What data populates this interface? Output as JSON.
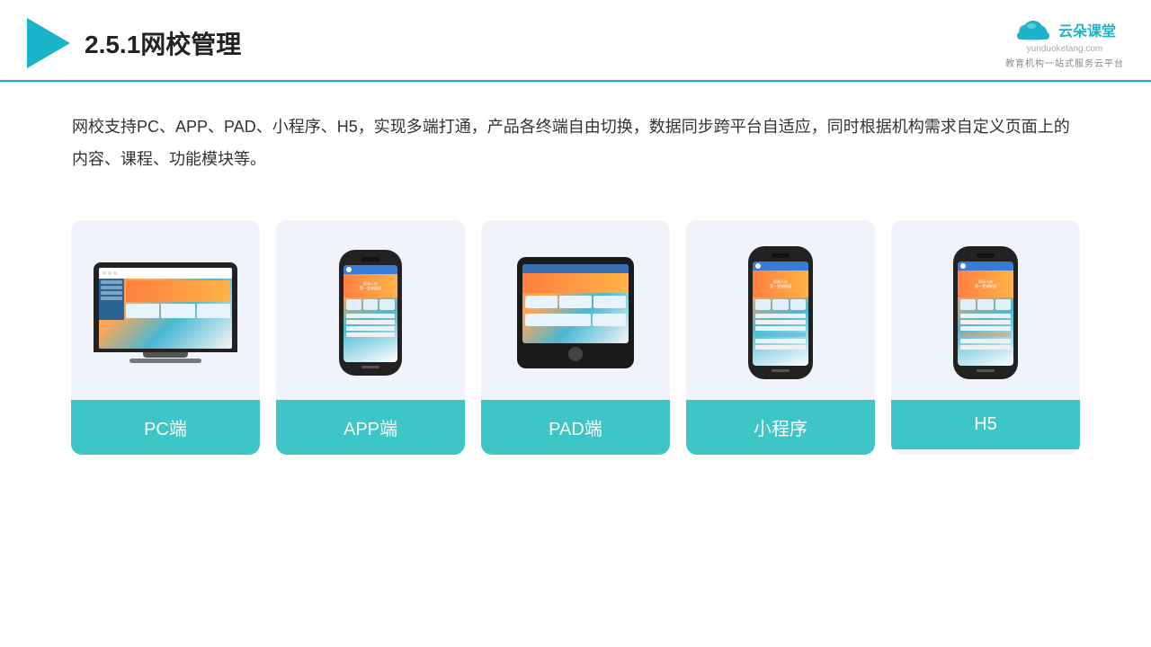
{
  "header": {
    "title": "2.5.1网校管理",
    "brand_name": "云朵课堂",
    "brand_url": "yunduoketang.com",
    "brand_subtitle": "教育机构一站\n式服务云平台"
  },
  "description": {
    "text": "网校支持PC、APP、PAD、小程序、H5，实现多端打通，产品各终端自由切换，数据同步跨平台自适应，同时根据机构需求自定义页面上的内容、课程、功能模块等。"
  },
  "cards": [
    {
      "id": "pc",
      "label": "PC端"
    },
    {
      "id": "app",
      "label": "APP端"
    },
    {
      "id": "pad",
      "label": "PAD端"
    },
    {
      "id": "mini",
      "label": "小程序"
    },
    {
      "id": "h5",
      "label": "H5"
    }
  ],
  "colors": {
    "teal": "#3ec5c5",
    "accent": "#1ab3c8",
    "card_bg": "#f0f4fa"
  }
}
